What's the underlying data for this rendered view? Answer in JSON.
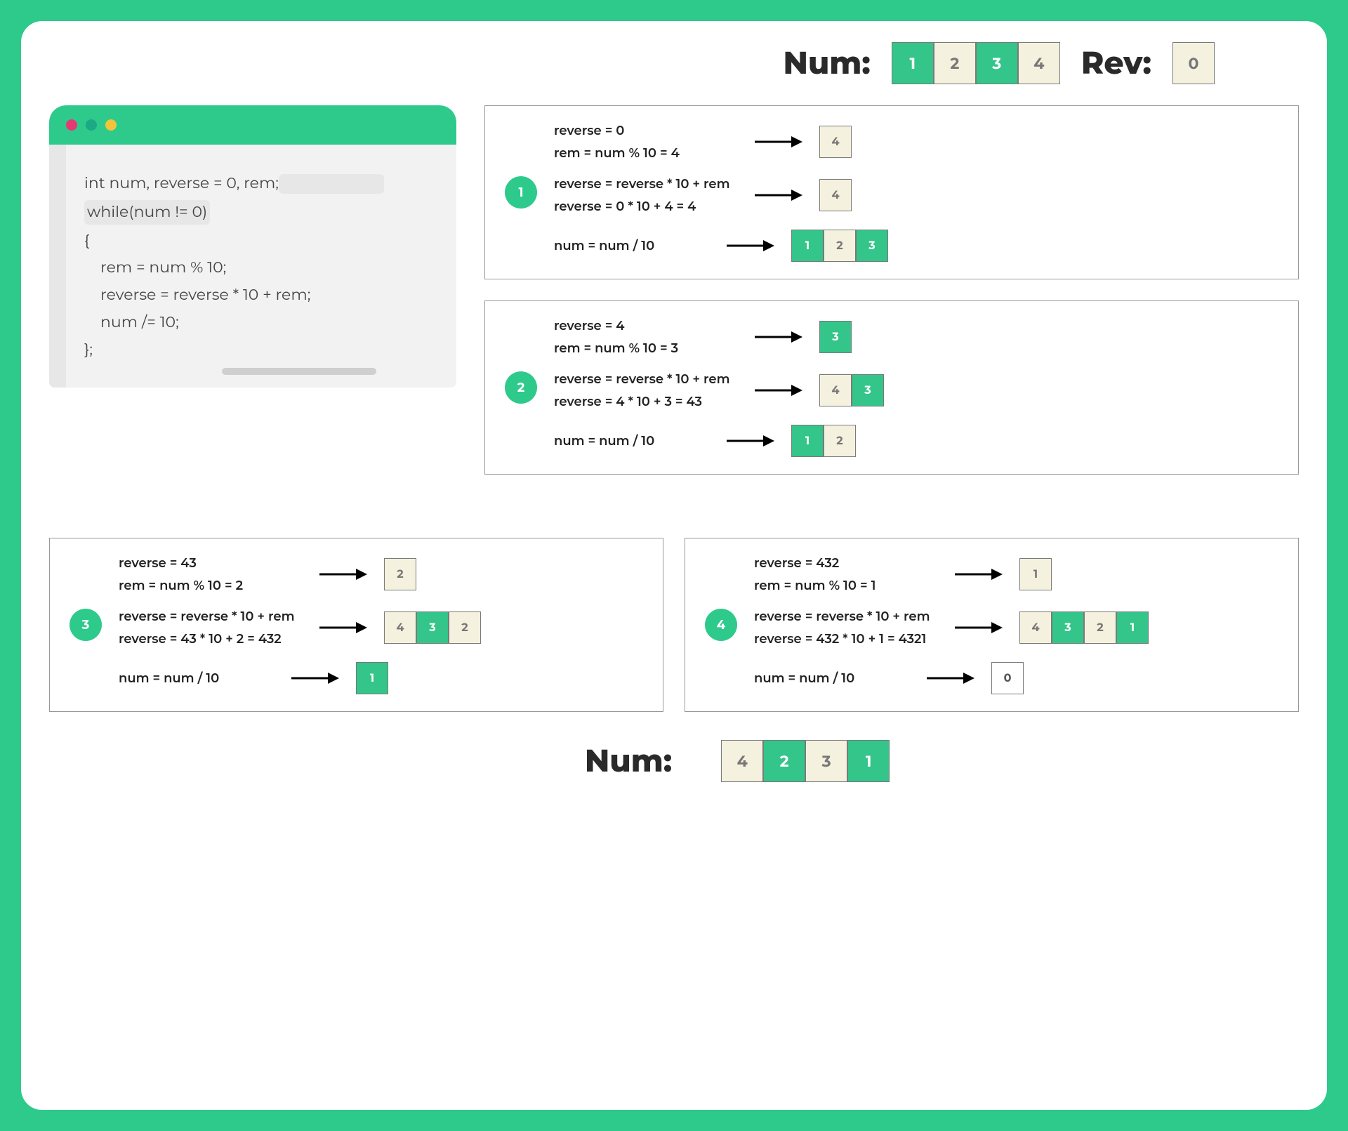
{
  "header": {
    "num_label": "Num:",
    "rev_label": "Rev:",
    "num_digits": [
      {
        "v": "1",
        "c": "green"
      },
      {
        "v": "2",
        "c": "cream"
      },
      {
        "v": "3",
        "c": "green"
      },
      {
        "v": "4",
        "c": "cream"
      }
    ],
    "rev_digits": [
      {
        "v": "0",
        "c": "cream"
      }
    ]
  },
  "code": {
    "l1": "int num, reverse = 0, rem;",
    "l2": "",
    "l3": "while(num != 0)",
    "l4": "{",
    "l5": "    rem = num % 10;",
    "l6": "    reverse = reverse * 10 + rem;",
    "l7": "    num /= 10;",
    "l8": "};"
  },
  "steps": [
    {
      "n": "1",
      "r0": "reverse = 0",
      "rem": "rem = num % 10 = 4",
      "rem_digits": [
        {
          "v": "4",
          "c": "cream"
        }
      ],
      "rev1": "reverse = reverse * 10 + rem",
      "rev2": "reverse = 0 * 10 + 4 = 4",
      "rev_digits": [
        {
          "v": "4",
          "c": "cream"
        }
      ],
      "num": "num = num / 10",
      "num_digits": [
        {
          "v": "1",
          "c": "green"
        },
        {
          "v": "2",
          "c": "cream"
        },
        {
          "v": "3",
          "c": "green"
        }
      ]
    },
    {
      "n": "2",
      "r0": "reverse = 4",
      "rem": "rem = num % 10 = 3",
      "rem_digits": [
        {
          "v": "3",
          "c": "green"
        }
      ],
      "rev1": "reverse = reverse * 10 + rem",
      "rev2": "reverse = 4 * 10 + 3 = 43",
      "rev_digits": [
        {
          "v": "4",
          "c": "cream"
        },
        {
          "v": "3",
          "c": "green"
        }
      ],
      "num": "num = num / 10",
      "num_digits": [
        {
          "v": "1",
          "c": "green"
        },
        {
          "v": "2",
          "c": "cream"
        }
      ]
    },
    {
      "n": "3",
      "r0": "reverse = 43",
      "rem": "rem = num % 10 = 2",
      "rem_digits": [
        {
          "v": "2",
          "c": "cream"
        }
      ],
      "rev1": "reverse = reverse * 10 + rem",
      "rev2": "reverse = 43 * 10 + 2 = 432",
      "rev_digits": [
        {
          "v": "4",
          "c": "cream"
        },
        {
          "v": "3",
          "c": "green"
        },
        {
          "v": "2",
          "c": "cream"
        }
      ],
      "num": "num = num / 10",
      "num_digits": [
        {
          "v": "1",
          "c": "green"
        }
      ]
    },
    {
      "n": "4",
      "r0": "reverse = 432",
      "rem": "rem = num % 10 = 1",
      "rem_digits": [
        {
          "v": "1",
          "c": "cream"
        }
      ],
      "rev1": "reverse = reverse * 10 + rem",
      "rev2": "reverse = 432 * 10 + 1 = 4321",
      "rev_digits": [
        {
          "v": "4",
          "c": "cream"
        },
        {
          "v": "3",
          "c": "green"
        },
        {
          "v": "2",
          "c": "cream"
        },
        {
          "v": "1",
          "c": "green"
        }
      ],
      "num": "num = num / 10",
      "num_digits": [
        {
          "v": "0",
          "c": "white"
        }
      ]
    }
  ],
  "footer": {
    "label": "Num:",
    "digits": [
      {
        "v": "4",
        "c": "cream"
      },
      {
        "v": "2",
        "c": "green"
      },
      {
        "v": "3",
        "c": "cream"
      },
      {
        "v": "1",
        "c": "green"
      }
    ]
  }
}
